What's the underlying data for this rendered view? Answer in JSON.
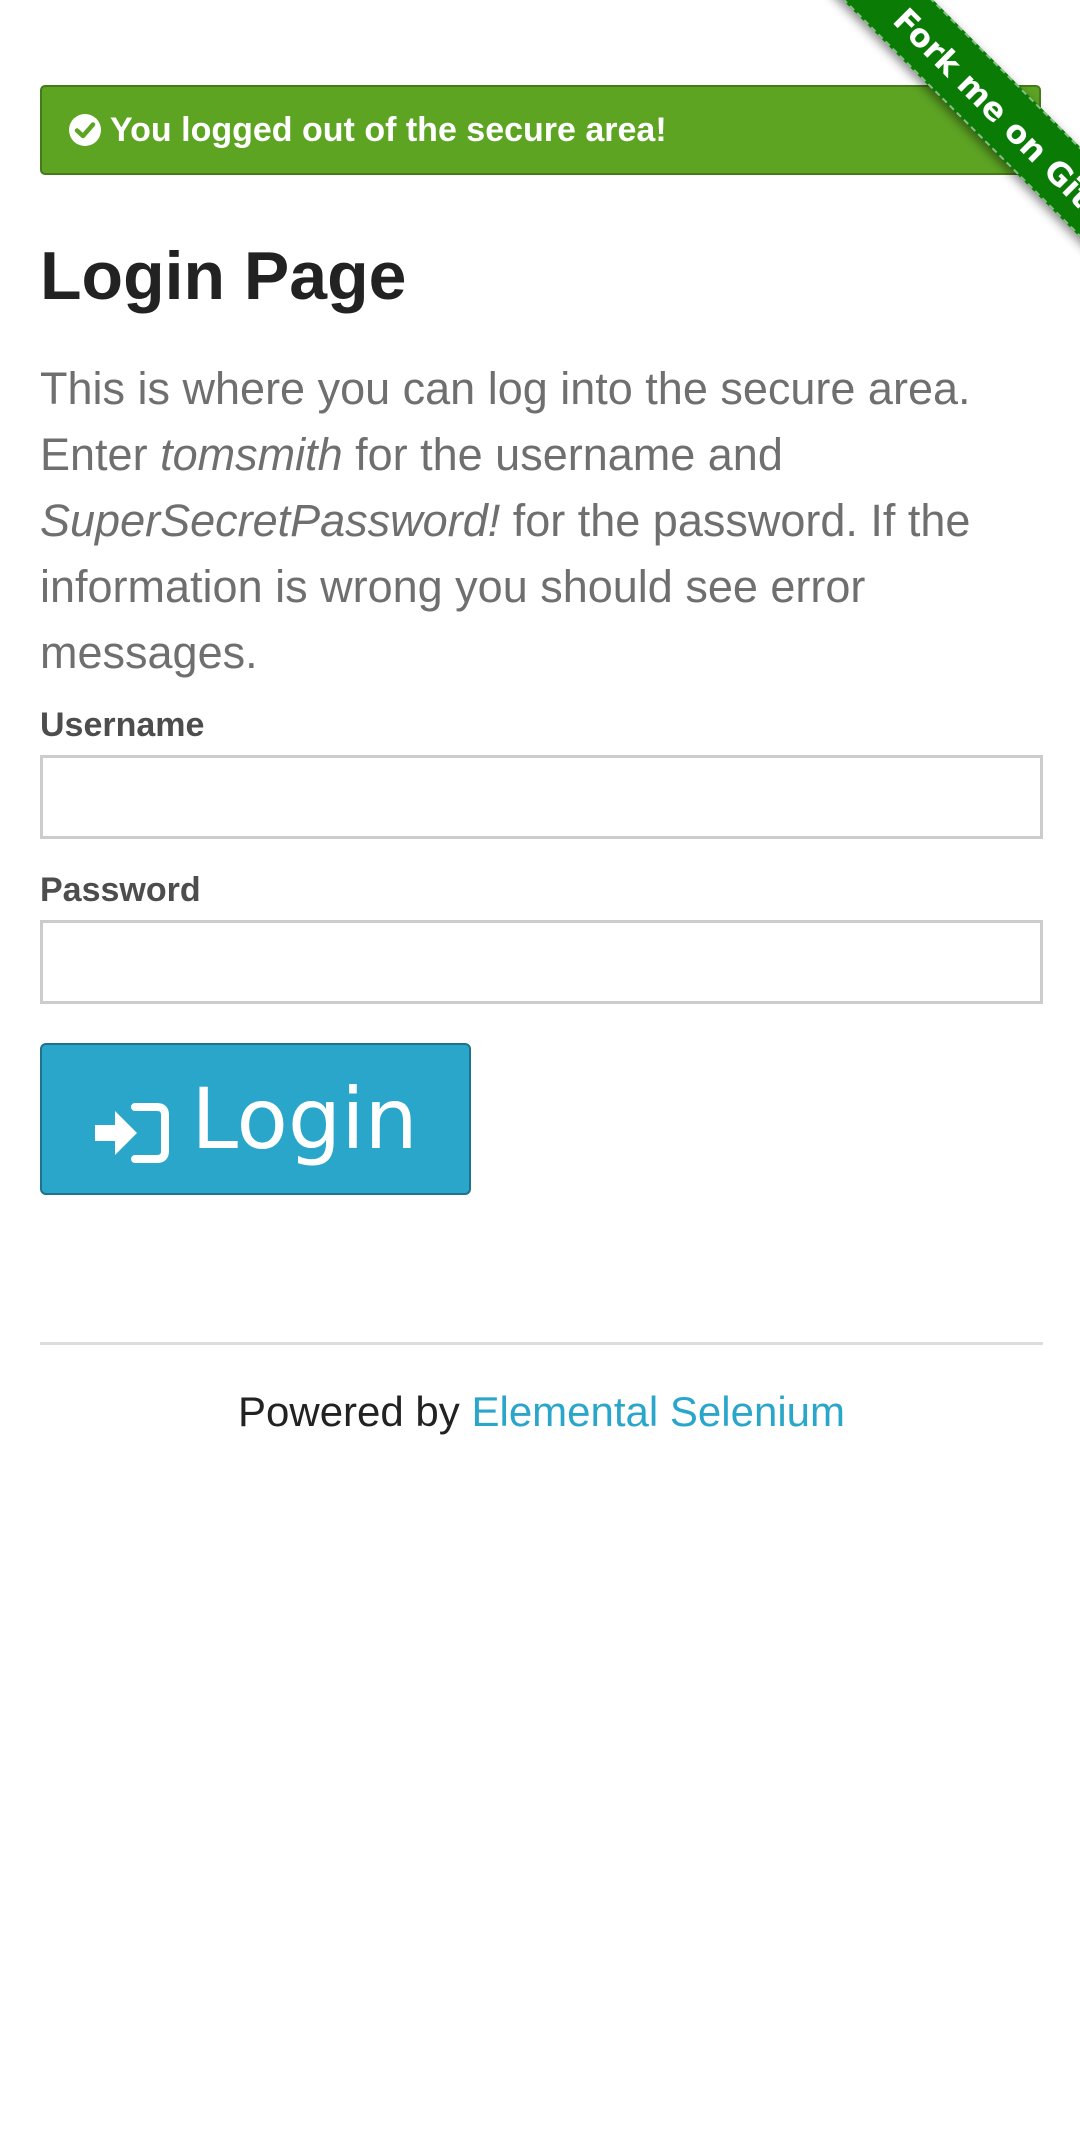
{
  "flash": {
    "message": "You logged out of the secure area!",
    "close_label": "×",
    "check_icon": "check-circle-icon",
    "color": "#5da423"
  },
  "ribbon": {
    "label": "Fork me on GitHub",
    "color": "#0a7c06"
  },
  "page": {
    "title": "Login Page",
    "intro_part1": "This is where you can log into the secure area. Enter ",
    "username_hint": "tomsmith",
    "intro_part2": " for the username and ",
    "password_hint": "SuperSecretPassword!",
    "intro_part3": " for the password. If the information is wrong you should see error messages."
  },
  "form": {
    "username_label": "Username",
    "username_value": "",
    "password_label": "Password",
    "password_value": "",
    "login_label": "Login",
    "login_icon": "sign-in-icon",
    "button_color": "#2ba6cb"
  },
  "footer": {
    "powered_by": "Powered by ",
    "link_text": "Elemental Selenium",
    "link_color": "#2ba6cb"
  }
}
